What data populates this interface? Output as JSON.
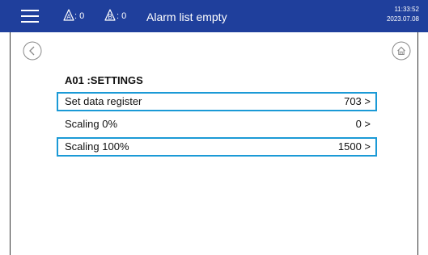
{
  "topbar": {
    "alarm_a": {
      "letter": "A",
      "count": ": 0"
    },
    "alarm_b": {
      "letter": "B",
      "count": ": 0"
    },
    "alarm_status": "Alarm list empty",
    "time": "11:33:52",
    "date": "2023.07.08"
  },
  "colors": {
    "topbar": "#1f3f9c",
    "selection_border": "#1b9ad6",
    "icon_gray": "#8a8a8a"
  },
  "icons": {
    "menu": "hamburger-icon",
    "alarm_a": "alarm-bell-a-icon",
    "alarm_b": "alarm-bell-b-icon",
    "back": "back-arrow-icon",
    "home": "home-icon"
  },
  "page": {
    "title": "A01 :SETTINGS",
    "rows": [
      {
        "label": "Set data register",
        "value": "703 >",
        "selected": true
      },
      {
        "label": "Scaling 0%",
        "value": "0 >",
        "selected": false
      },
      {
        "label": "Scaling 100%",
        "value": "1500 >",
        "selected": true
      }
    ]
  }
}
